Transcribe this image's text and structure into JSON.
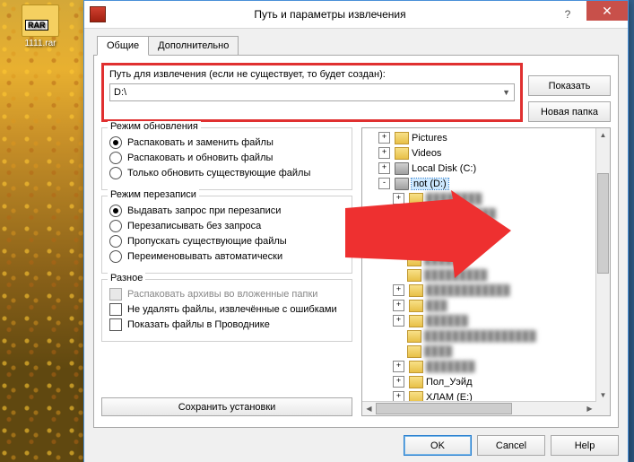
{
  "desktop": {
    "icon_label": "1111.rar",
    "icon_badge": "RAR"
  },
  "dialog": {
    "title": "Путь и параметры извлечения",
    "tabs": {
      "general": "Общие",
      "advanced": "Дополнительно"
    },
    "path_label": "Путь для извлечения (если не существует, то будет создан):",
    "path_value": "D:\\",
    "buttons": {
      "show": "Показать",
      "new_folder": "Новая папка",
      "save_settings": "Сохранить установки",
      "ok": "OK",
      "cancel": "Cancel",
      "help": "Help"
    },
    "groups": {
      "update": {
        "title": "Режим обновления",
        "opts": [
          "Распаковать и заменить файлы",
          "Распаковать и обновить файлы",
          "Только обновить существующие файлы"
        ],
        "selected": 0
      },
      "overwrite": {
        "title": "Режим перезаписи",
        "opts": [
          "Выдавать запрос при перезаписи",
          "Перезаписывать без запроса",
          "Пропускать существующие файлы",
          "Переименовывать автоматически"
        ],
        "selected": 0
      },
      "misc": {
        "title": "Разное",
        "opts": [
          "Распаковать архивы во вложенные папки",
          "Не удалять файлы, извлечённые с ошибками",
          "Показать файлы в Проводнике"
        ]
      }
    },
    "tree": {
      "items": [
        {
          "indent": 1,
          "exp": "+",
          "icon": "folder",
          "label": "Pictures"
        },
        {
          "indent": 1,
          "exp": "+",
          "icon": "folder",
          "label": "Videos"
        },
        {
          "indent": 1,
          "exp": "+",
          "icon": "drive",
          "label": "Local Disk (C:)"
        },
        {
          "indent": 1,
          "exp": "-",
          "icon": "drive",
          "label": "not (D:)",
          "selected": true
        },
        {
          "indent": 2,
          "exp": "+",
          "icon": "folder",
          "label": "████████",
          "blur": true
        },
        {
          "indent": 2,
          "exp": "+",
          "icon": "folder",
          "label": "██████████",
          "blur": true
        },
        {
          "indent": 2,
          "exp": "",
          "icon": "folder",
          "label": "█████",
          "blur": true
        },
        {
          "indent": 2,
          "exp": "",
          "icon": "folder",
          "label": "████████",
          "blur": true
        },
        {
          "indent": 2,
          "exp": "",
          "icon": "folder",
          "label": "██████",
          "blur": true
        },
        {
          "indent": 2,
          "exp": "",
          "icon": "folder",
          "label": "█████████",
          "blur": true
        },
        {
          "indent": 2,
          "exp": "+",
          "icon": "folder",
          "label": "████████████",
          "blur": true
        },
        {
          "indent": 2,
          "exp": "+",
          "icon": "folder",
          "label": "███",
          "blur": true
        },
        {
          "indent": 2,
          "exp": "+",
          "icon": "folder",
          "label": "██████",
          "blur": true
        },
        {
          "indent": 2,
          "exp": "",
          "icon": "folder",
          "label": "████████████████",
          "blur": true
        },
        {
          "indent": 2,
          "exp": "",
          "icon": "folder",
          "label": "████",
          "blur": true
        },
        {
          "indent": 2,
          "exp": "+",
          "icon": "folder",
          "label": "███████",
          "blur": true
        },
        {
          "indent": 2,
          "exp": "+",
          "icon": "folder",
          "label": "Пол_Уэйд"
        },
        {
          "indent": 2,
          "exp": "+",
          "icon": "folder",
          "label": "ХЛАМ (E:)"
        }
      ]
    }
  }
}
